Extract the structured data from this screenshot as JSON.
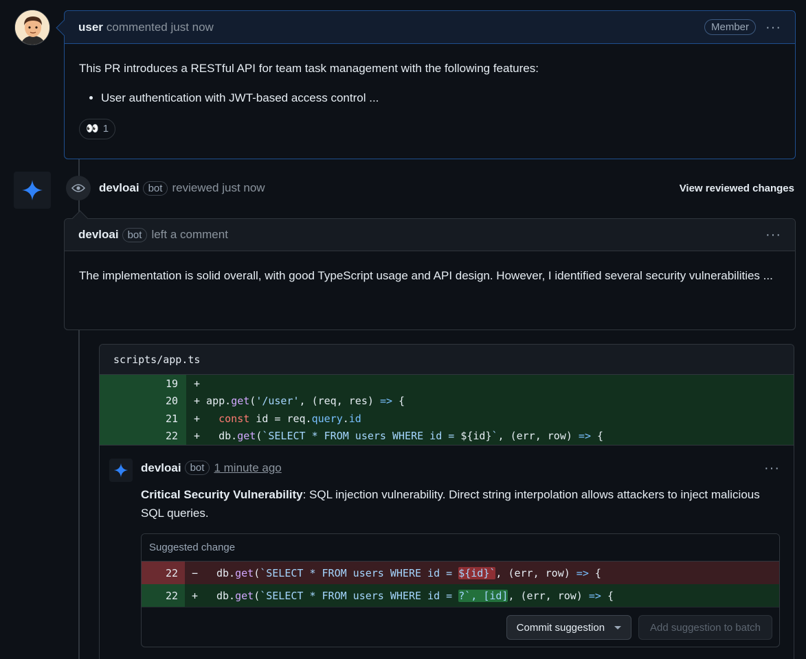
{
  "comment1": {
    "author": "user",
    "action": "commented just now",
    "badge": "Member",
    "body_intro": "This PR introduces a RESTful API for team task management with the following features:",
    "bullets": [
      "User authentication with JWT-based access control ..."
    ],
    "reaction_emoji": "👀",
    "reaction_count": "1"
  },
  "review": {
    "author": "devloai",
    "badge": "bot",
    "action": "reviewed just now",
    "view_link": "View reviewed changes"
  },
  "comment2": {
    "author": "devloai",
    "badge": "bot",
    "action": "left a comment",
    "body": "The implementation is solid overall, with good TypeScript usage and API design. However, I identified several security vulnerabilities ..."
  },
  "thread": {
    "file": "scripts/app.ts",
    "lines": [
      {
        "num": "19",
        "sign": "+"
      },
      {
        "num": "20",
        "sign": "+"
      },
      {
        "num": "21",
        "sign": "+"
      },
      {
        "num": "22",
        "sign": "+"
      }
    ],
    "comment": {
      "author": "devloai",
      "badge": "bot",
      "time": "1 minute ago",
      "bold": "Critical Security Vulnerability",
      "text": ": SQL injection vulnerability. Direct string interpolation allows attackers to inject malicious SQL queries."
    },
    "suggestion": {
      "title": "Suggested change",
      "del_num": "22",
      "del_sign": "−",
      "add_num": "22",
      "add_sign": "+",
      "commit_label": "Commit suggestion",
      "batch_label": "Add suggestion to batch"
    }
  },
  "colors": {
    "accent_blue": "#1f6feb",
    "bot_star": "#2f81f7"
  }
}
